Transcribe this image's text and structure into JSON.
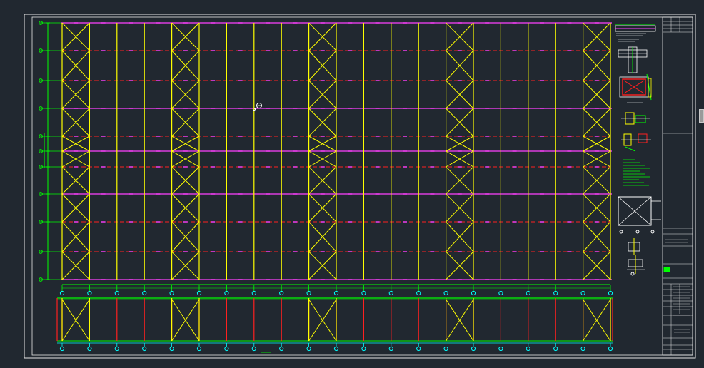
{
  "app": {
    "view": "CAD model space",
    "background_color": "#212830"
  },
  "colors": {
    "frame": "#e6e6e6",
    "column": "#ffff00",
    "brace": "#ffff00",
    "purlin_dashed": "#ff2020",
    "rafter": "#ff40ff",
    "grid_green": "#00ff00",
    "axis_bubble": "#00ffff",
    "detail_white": "#ffffff",
    "detail_green": "#00ff00"
  },
  "drawing": {
    "title": "",
    "icons": [
      "pan-cursor-icon",
      "axis-bubble-icon"
    ],
    "plan": {
      "bays": 20,
      "braced_bays": [
        0,
        4,
        9,
        14,
        19
      ],
      "purlin_rows": 9,
      "rafter_rows": [
        0,
        3,
        5,
        7,
        9
      ],
      "diagonal_rows_per_braced_bay": 9
    },
    "elevation": {
      "bays": 20,
      "braced_bays": [
        0,
        4,
        9,
        14,
        19
      ]
    }
  },
  "title_block": {
    "fields": [
      "",
      "",
      "",
      "",
      "",
      "",
      "",
      ""
    ]
  }
}
